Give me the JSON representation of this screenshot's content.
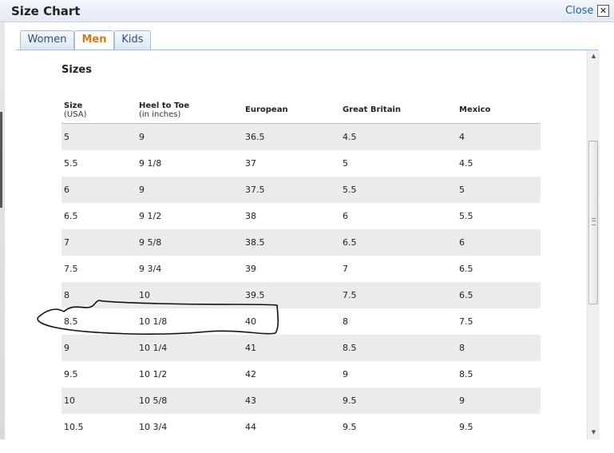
{
  "window": {
    "title": "Size Chart",
    "close_label": "Close",
    "close_glyph": "✕"
  },
  "tabs": [
    {
      "label": "Women",
      "active": false
    },
    {
      "label": "Men",
      "active": true
    },
    {
      "label": "Kids",
      "active": false
    }
  ],
  "section_heading": "Sizes",
  "table": {
    "headers": [
      {
        "label": "Size",
        "sub": "(USA)"
      },
      {
        "label": "Heel to Toe",
        "sub": "(in inches)"
      },
      {
        "label": "European",
        "sub": ""
      },
      {
        "label": "Great Britain",
        "sub": ""
      },
      {
        "label": "Mexico",
        "sub": ""
      }
    ],
    "rows": [
      [
        "5",
        "9",
        "36.5",
        "4.5",
        "4"
      ],
      [
        "5.5",
        "9 1/8",
        "37",
        "5",
        "4.5"
      ],
      [
        "6",
        "9",
        "37.5",
        "5.5",
        "5"
      ],
      [
        "6.5",
        "9 1/2",
        "38",
        "6",
        "5.5"
      ],
      [
        "7",
        "9 5/8",
        "38.5",
        "6.5",
        "6"
      ],
      [
        "7.5",
        "9 3/4",
        "39",
        "7",
        "6.5"
      ],
      [
        "8",
        "10",
        "39.5",
        "7.5",
        "6.5"
      ],
      [
        "8.5",
        "10 1/8",
        "40",
        "8",
        "7.5"
      ],
      [
        "9",
        "10 1/4",
        "41",
        "8.5",
        "8"
      ],
      [
        "9.5",
        "10 1/2",
        "42",
        "9",
        "8.5"
      ],
      [
        "10",
        "10 5/8",
        "43",
        "9.5",
        "9"
      ],
      [
        "10.5",
        "10 3/4",
        "44",
        "9.5",
        "9.5"
      ]
    ]
  },
  "colors": {
    "active_tab": "#d07a1a",
    "link": "#1f5fa8",
    "stripe": "#ebebeb"
  }
}
